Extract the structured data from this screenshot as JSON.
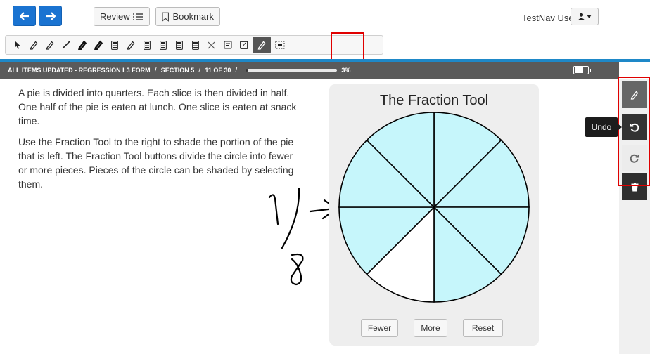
{
  "header": {
    "prev_icon": "arrow-left-icon",
    "next_icon": "arrow-right-icon",
    "review_label": "Review",
    "bookmark_label": "Bookmark",
    "user_label": "TestNav User"
  },
  "toolbar": {
    "tools": [
      "pointer-icon",
      "highlighter-icon",
      "eraser-icon",
      "line-icon",
      "pen-icon",
      "pen-icon",
      "calculator-icon",
      "highlighter-icon",
      "calculator-icon",
      "calculator-icon",
      "calculator-icon",
      "calculator-icon",
      "close-icon",
      "notepad-icon",
      "notepad-icon",
      "pencil-icon",
      "screen-icon"
    ],
    "active_tool": "pencil-icon"
  },
  "breadcrumb": {
    "form": "ALL ITEMS UPDATED - REGRESSION L3 FORM",
    "section": "SECTION 5",
    "position": "11 OF 30",
    "progress": 0.03,
    "percent": "3%"
  },
  "question": {
    "para1": "A pie is divided into quarters. Each slice is then divided in half. One half of the pie is eaten at lunch. One slice is eaten at snack time.",
    "para2": "Use the Fraction Tool to the right to shade the portion of the pie that is left. The Fraction Tool buttons divide the circle into fewer or more pieces. Pieces of the circle can be shaded by selecting them."
  },
  "fraction_tool": {
    "title": "The Fraction Tool",
    "pieces": 8,
    "shaded_color": "#c6f6fb",
    "unshaded_index": 4,
    "fewer_label": "Fewer",
    "more_label": "More",
    "reset_label": "Reset"
  },
  "right_tools": {
    "undo_tooltip": "Undo",
    "icons": [
      "pencil-icon",
      "undo-icon",
      "redo-icon",
      "trash-icon"
    ]
  },
  "colors": {
    "nav_blue": "#1a73d1",
    "highlight_red": "#e00000",
    "crumb_bg": "#5a5a5a",
    "rule_blue": "#1e88c8"
  }
}
